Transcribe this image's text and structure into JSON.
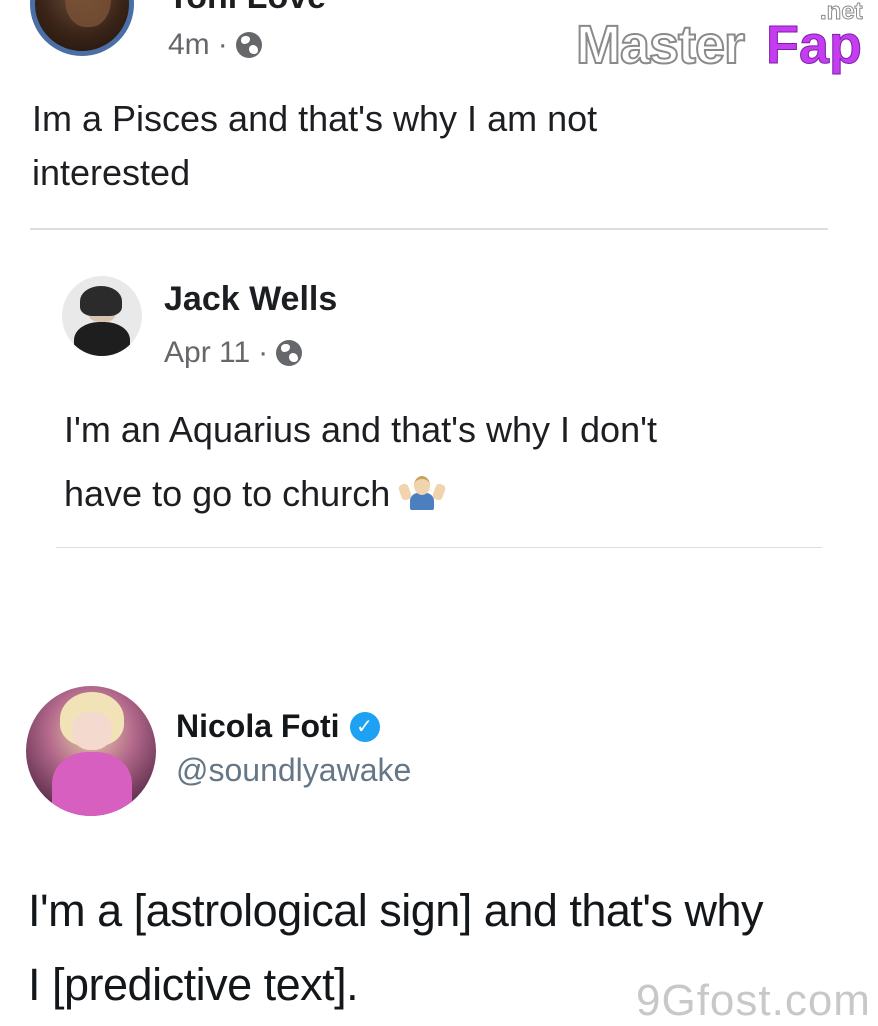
{
  "top_post": {
    "author_name": "Toni Love",
    "time": "4m",
    "separator": "·",
    "privacy_icon": "globe-icon",
    "text_line1": "Im a Pisces and that's why I am not",
    "text_line2": "interested"
  },
  "watermark": {
    "brand_part1": "Master",
    "brand_part2": "Fap",
    "brand_suffix": ".net",
    "bottom_text": "9Gfost.com"
  },
  "quoted_post": {
    "author_name": "Jack Wells",
    "time": "Apr 11",
    "separator": "·",
    "privacy_icon": "globe-icon",
    "text_line1": "I'm an Aquarius and that's why I don't",
    "text_line2": "have to go to church",
    "emoji": "person-shrugging"
  },
  "tweet": {
    "author_name": "Nicola Foti",
    "verified_icon": "verified-badge-icon",
    "handle": "@soundlyawake",
    "text_line1": "I'm a [astrological sign] and that's why",
    "text_line2": "I [predictive text]."
  },
  "colors": {
    "text_primary": "#1c1e21",
    "text_secondary": "#65676b",
    "avatar_ring": "#4a6fa5",
    "twitter_blue": "#1da1f2",
    "handle_gray": "#657786",
    "divider": "#dadde1",
    "brand_purple": "#c63cf0"
  }
}
